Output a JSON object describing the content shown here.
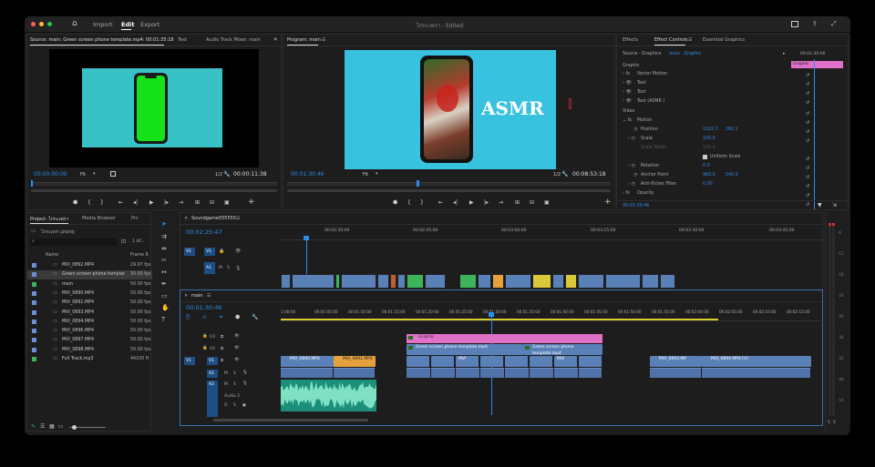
{
  "window": {
    "title": "ไก่กะเพรา - Edited"
  },
  "topnav": {
    "import": "Import",
    "edit": "Edit",
    "export": "Export"
  },
  "source": {
    "tab": "Source: main: Green screen phone template.mp4: 00:01:35:18",
    "tab2": "Text",
    "tab3": "Audio Track Mixer: main",
    "tc_left": "00:00:00:00",
    "fit": "Fit",
    "ratio": "1/2",
    "tc_right": "00:00:11:38"
  },
  "program": {
    "tab": "Program: main",
    "tc_left": "00:01:30:46",
    "fit": "Fit",
    "ratio": "1/2",
    "tc_right": "00:08:53:18",
    "overlay_text": "ASMR"
  },
  "effects": {
    "tab1": "Effects",
    "tab2": "Effect Controls",
    "tab3": "Essential Graphics",
    "source_label": "Source · Graphic",
    "seq_label": "main · Graphic",
    "tc_top": "00:01:30:00",
    "graphic_bar": "Graphic",
    "graphic_hdr": "Graphic",
    "rows": [
      "Vector Motion",
      "Text",
      "Text",
      "Text (ASMR )"
    ],
    "video_hdr": "Video",
    "motion": "Motion",
    "position": "Position",
    "pos_x": "1322.7",
    "pos_y": "260.1",
    "scale": "Scale",
    "scale_val": "100.0",
    "scale_width": "Scale Width",
    "scale_width_val": "100.0",
    "uniform": "Uniform Scale",
    "rotation": "Rotation",
    "rot_val": "0.0",
    "anchor": "Anchor Point",
    "anc_x": "960.0",
    "anc_y": "540.0",
    "antiflicker": "Anti-flicker Filter",
    "af_val": "0.00",
    "opacity": "Opacity",
    "bottom_tc": "00:01:30:46"
  },
  "project": {
    "tab": "Project: ไก่กะเพรา",
    "tab2": "Media Browser",
    "tab3": "Prc",
    "file": "ไก่กะเพรา.prproj",
    "count": "1 of...",
    "col_name": "Name",
    "col_fr": "Frame R",
    "items": [
      {
        "name": "MVI_0892.MP4",
        "fr": "29.97 fps",
        "color": "#6b8fd6"
      },
      {
        "name": "Green screen phone templat",
        "fr": "30.00 fps",
        "color": "#6b8fd6"
      },
      {
        "name": "main",
        "fr": "50.00 fps",
        "color": "#3db35a"
      },
      {
        "name": "MVI_0890.MP4",
        "fr": "50.00 fps",
        "color": "#6b8fd6"
      },
      {
        "name": "MVI_0891.MP4",
        "fr": "50.00 fps",
        "color": "#6b8fd6"
      },
      {
        "name": "MVI_0893.MP4",
        "fr": "50.00 fps",
        "color": "#6b8fd6"
      },
      {
        "name": "MVI_0894.MP4",
        "fr": "50.00 fps",
        "color": "#6b8fd6"
      },
      {
        "name": "MVI_0896.MP4",
        "fr": "50.00 fps",
        "color": "#6b8fd6"
      },
      {
        "name": "MVI_0897.MP4",
        "fr": "50.00 fps",
        "color": "#6b8fd6"
      },
      {
        "name": "MVI_0898.MP4",
        "fr": "50.00 fps",
        "color": "#6b8fd6"
      },
      {
        "name": "Full Track.mp3",
        "fr": "44100 H",
        "color": "#3db35a"
      }
    ]
  },
  "seq1": {
    "tab": "Soundgame555555",
    "tc": "00:02:25:47",
    "ruler": [
      "00:02:30:00",
      "00:02:45:00",
      "00:03:00:00",
      "00:03:15:00",
      "00:03:30:00",
      "00:03:45:00"
    ],
    "v1": "V1",
    "a1": "A1"
  },
  "seq2": {
    "tab": "main",
    "tc": "00:01:30:46",
    "ruler": [
      "1:00:00",
      "00:01:05:00",
      "00:01:10:00",
      "00:01:15:00",
      "00:01:20:00",
      "00:01:25:00",
      "00:01:30:00",
      "00:01:35:00",
      "00:01:40:00",
      "00:01:45:00",
      "00:01:50:00",
      "00:01:55:00",
      "00:02:00:00",
      "00:02:05:00",
      "00:02:10:00",
      "00:02:15:00"
    ],
    "tracks": {
      "v3": "V3",
      "v2": "V2",
      "v1": "V1",
      "a1": "A1",
      "a2": "A2",
      "audio2": "Audio 2",
      "o": "O"
    },
    "clips": {
      "graphic": "Graphic",
      "gs1": "Green screen phone template.mp4",
      "gs2": "Green screen phone template.mp4",
      "c1": "MVI_0890.MP4",
      "c2": "MVI_0891.MP4",
      "c3": "MVI",
      "c4": "MVI",
      "c5": "MVI_0893.MP",
      "c6": "MVI_0894.MP4 [V]"
    }
  },
  "meter": {
    "labels": [
      "-6",
      "-12",
      "-18",
      "-24",
      "-30",
      "-36",
      "-42",
      "-48",
      "-54"
    ],
    "s1": "S",
    "s2": "S"
  },
  "icons": {
    "home": "⌂",
    "close": "✕"
  }
}
